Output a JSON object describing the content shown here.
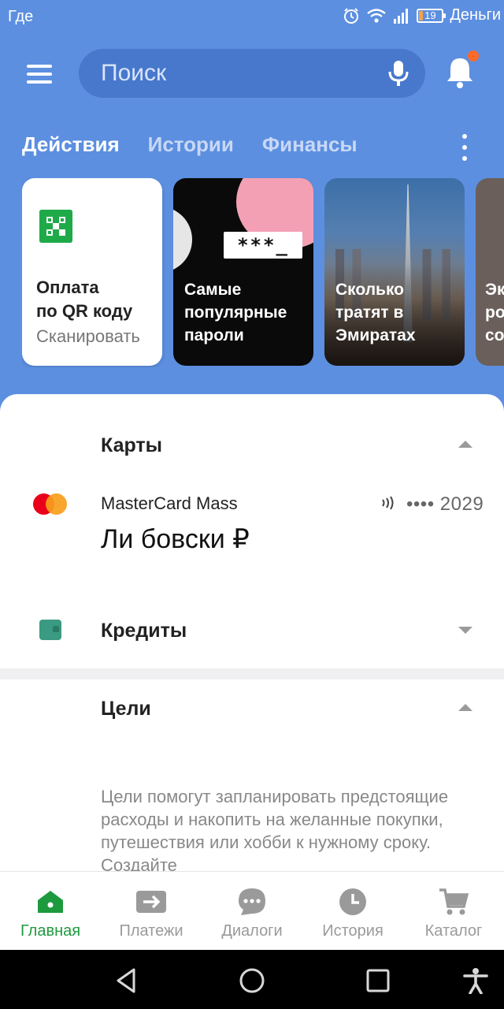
{
  "status_bar": {
    "left_text": "Где",
    "battery": "19",
    "battery_level": 0.19,
    "right_text": "Деньги"
  },
  "header": {
    "search_placeholder": "Поиск",
    "colors": {
      "header_bg": "#5c8fe0",
      "notification_dot": "#ff6a2a"
    }
  },
  "tabs": [
    {
      "label": "Действия",
      "active": true
    },
    {
      "label": "Истории",
      "active": false
    },
    {
      "label": "Финансы",
      "active": false
    }
  ],
  "stories": {
    "qr": {
      "title": "Оплата\nпо QR коду",
      "subtitle": "Сканировать"
    },
    "passwords": {
      "title": "Самые\nпопулярные\nпароли",
      "badge": "***_"
    },
    "emirates": {
      "title": "Сколько\nтратят в\nЭмиратах"
    },
    "partial": {
      "title": "Эк\nро\nсо"
    }
  },
  "cards_section": {
    "title": "Карты",
    "card": {
      "name": "MasterCard Mass",
      "balance": "Ли бовски ₽",
      "number": "•••• 2029"
    }
  },
  "credits_section": {
    "title": "Кредиты"
  },
  "goals_section": {
    "title": "Цели",
    "description": "Цели помогут запланировать предстоящие расходы и накопить на желанные покупки, путешествия или хобби к нужному сроку. Создайте"
  },
  "bottom_nav": [
    {
      "label": "Главная",
      "icon": "home-icon",
      "active": true
    },
    {
      "label": "Платежи",
      "icon": "transfer-icon",
      "active": false
    },
    {
      "label": "Диалоги",
      "icon": "chat-icon",
      "active": false
    },
    {
      "label": "История",
      "icon": "clock-icon",
      "active": false
    },
    {
      "label": "Каталог",
      "icon": "cart-icon",
      "active": false
    }
  ],
  "colors": {
    "accent_green": "#1e9a3e",
    "mastercard_red": "#eb001b",
    "mastercard_orange": "#f79e1b"
  }
}
